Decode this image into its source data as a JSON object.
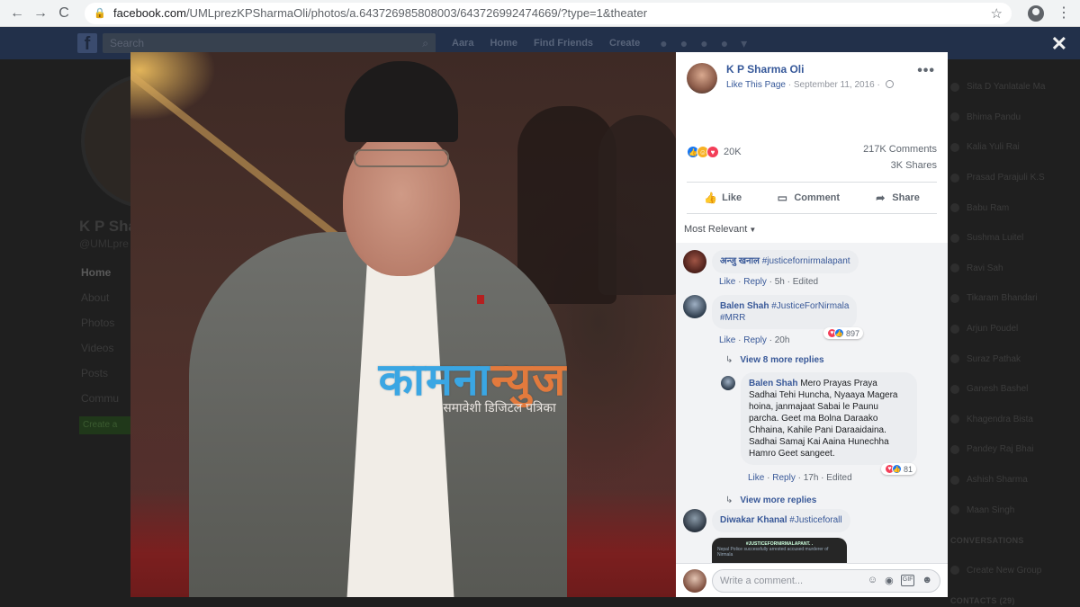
{
  "browser": {
    "url_host": "facebook.com",
    "url_path": "/UMLprezKPSharmaOli/photos/a.643726985808003/643726992474669/?type=1&theater",
    "back_icon": "←",
    "forward_icon": "→",
    "reload_icon": "C",
    "star_icon": "☆",
    "kebab_icon": "⋮"
  },
  "fb_header": {
    "logo": "f",
    "search_placeholder": "Search",
    "nav": [
      "Aara",
      "Home",
      "Find Friends",
      "Create"
    ],
    "close": "✕"
  },
  "bg_page": {
    "name": "K P Sha",
    "handle": "@UMLpre",
    "menu": [
      "Home",
      "About",
      "Photos",
      "Videos",
      "Posts",
      "Commu"
    ],
    "create_btn": "Create a",
    "contacts": [
      "Sita D Yanlatale Ma",
      "Bhima Pandu",
      "Kalia Yuli Rai",
      "Prasad Parajuli K.S",
      "Babu Ram",
      "Sushma Luitel",
      "Ravi Sah",
      "Tikaram Bhandari",
      "Arjun Poudel",
      "Suraz Pathak",
      "Ganesh Bashel",
      "Khagendra Bista",
      "Pandey Raj Bhai",
      "Ashish Sharma",
      "Maan Singh",
      "CONVERSATIONS",
      "Create New Group",
      "CONTACTS (29)"
    ]
  },
  "watermark": {
    "title_a": "कामना",
    "title_b": "न्युज",
    "subtitle": "समावेशी डिजिटल पत्रिका"
  },
  "post": {
    "author": "K P Sharma Oli",
    "like_page": "Like This Page",
    "separator": " · ",
    "date": "September 11, 2016",
    "separator2": " · ",
    "more": "•••",
    "reaction_count": "20K",
    "comments_count": "217K Comments",
    "shares_count": "3K Shares",
    "actions": {
      "like": "Like",
      "comment": "Comment",
      "share": "Share"
    },
    "sort": "Most Relevant"
  },
  "comments": [
    {
      "name": "अन्जु खनाल",
      "text": "#justicefornirmalapant",
      "like": "Like",
      "reply": "Reply",
      "time": "5h",
      "edited": "Edited"
    },
    {
      "name": "Balen Shah",
      "text_line1": "#JusticeForNirmala",
      "text_line2": "#MRR",
      "like": "Like",
      "reply": "Reply",
      "time": "20h",
      "reactions": "897"
    },
    {
      "more_replies": "View 8 more replies"
    },
    {
      "name": "Balen Shah",
      "text_line1": "Mero Prayas Praya",
      "text_line2": "Sadhai Tehi Huncha, Nyaaya Magera",
      "text_line3": "hoina, janmajaat Sabai le Paunu",
      "text_line4": "parcha. Geet ma Bolna Daraako",
      "text_line5": "Chhaina, Kahile Pani Daraaidaina.",
      "text_line6": "Sadhai Samaj Kai Aaina Hunechha",
      "text_line7": "Hamro Geet sangeet.",
      "like": "Like",
      "reply": "Reply",
      "time": "17h",
      "edited": "Edited",
      "reactions": "81"
    },
    {
      "more_replies": "View more replies"
    },
    {
      "name": "Diwakar Khanal",
      "text": "#Justiceforall"
    }
  ],
  "preview": {
    "heading": "#JUSTICEFORNIRMALAPANT. .",
    "line1": "Nepal Police successfully arrested accused murderer of",
    "line2": "Nirmala"
  },
  "composer": {
    "placeholder": "Write a comment..."
  },
  "colors": {
    "fb_blue": "#365899",
    "link": "#385898",
    "like": "#1877f2",
    "love": "#f33e58",
    "haha": "#f7b125"
  }
}
